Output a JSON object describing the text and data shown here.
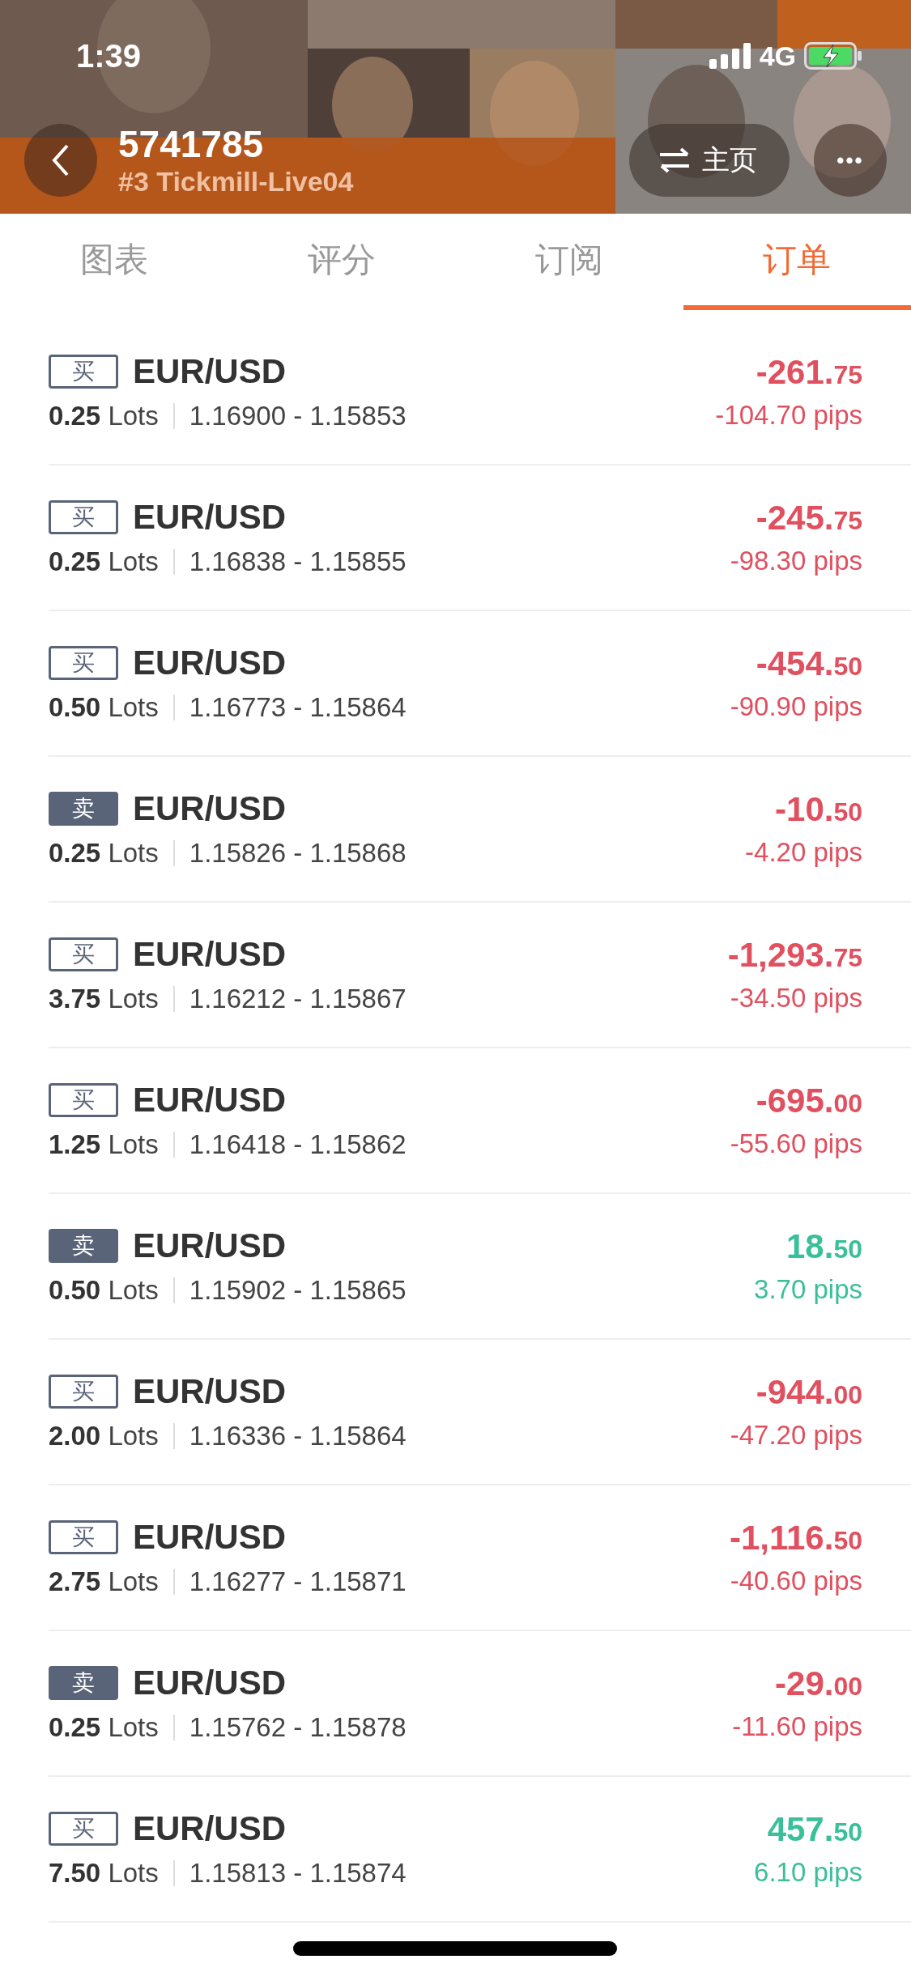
{
  "status_bar": {
    "time": "1:39",
    "network": "4G"
  },
  "header": {
    "title": "5741785",
    "subtitle": "#3 Tickmill-Live04",
    "home_button": "主页",
    "more_button": "•••"
  },
  "tabs": [
    {
      "label": "图表",
      "selected": false
    },
    {
      "label": "评分",
      "selected": false
    },
    {
      "label": "订阅",
      "selected": false
    },
    {
      "label": "订单",
      "selected": true
    }
  ],
  "orders": [
    {
      "sell": false,
      "side_label": "买",
      "symbol": "EUR/USD",
      "lots": "0.25",
      "lots_unit": "Lots",
      "prices": "1.16900 - 1.15853",
      "profit": false,
      "amount_main": "-261.",
      "amount_minor": "75",
      "pips": "-104.70 pips"
    },
    {
      "sell": false,
      "side_label": "买",
      "symbol": "EUR/USD",
      "lots": "0.25",
      "lots_unit": "Lots",
      "prices": "1.16838 - 1.15855",
      "profit": false,
      "amount_main": "-245.",
      "amount_minor": "75",
      "pips": "-98.30 pips"
    },
    {
      "sell": false,
      "side_label": "买",
      "symbol": "EUR/USD",
      "lots": "0.50",
      "lots_unit": "Lots",
      "prices": "1.16773 - 1.15864",
      "profit": false,
      "amount_main": "-454.",
      "amount_minor": "50",
      "pips": "-90.90 pips"
    },
    {
      "sell": true,
      "side_label": "卖",
      "symbol": "EUR/USD",
      "lots": "0.25",
      "lots_unit": "Lots",
      "prices": "1.15826 - 1.15868",
      "profit": false,
      "amount_main": "-10.",
      "amount_minor": "50",
      "pips": "-4.20 pips"
    },
    {
      "sell": false,
      "side_label": "买",
      "symbol": "EUR/USD",
      "lots": "3.75",
      "lots_unit": "Lots",
      "prices": "1.16212 - 1.15867",
      "profit": false,
      "amount_main": "-1,293.",
      "amount_minor": "75",
      "pips": "-34.50 pips"
    },
    {
      "sell": false,
      "side_label": "买",
      "symbol": "EUR/USD",
      "lots": "1.25",
      "lots_unit": "Lots",
      "prices": "1.16418 - 1.15862",
      "profit": false,
      "amount_main": "-695.",
      "amount_minor": "00",
      "pips": "-55.60 pips"
    },
    {
      "sell": true,
      "side_label": "卖",
      "symbol": "EUR/USD",
      "lots": "0.50",
      "lots_unit": "Lots",
      "prices": "1.15902 - 1.15865",
      "profit": true,
      "amount_main": "18.",
      "amount_minor": "50",
      "pips": "3.70 pips"
    },
    {
      "sell": false,
      "side_label": "买",
      "symbol": "EUR/USD",
      "lots": "2.00",
      "lots_unit": "Lots",
      "prices": "1.16336 - 1.15864",
      "profit": false,
      "amount_main": "-944.",
      "amount_minor": "00",
      "pips": "-47.20 pips"
    },
    {
      "sell": false,
      "side_label": "买",
      "symbol": "EUR/USD",
      "lots": "2.75",
      "lots_unit": "Lots",
      "prices": "1.16277 - 1.15871",
      "profit": false,
      "amount_main": "-1,116.",
      "amount_minor": "50",
      "pips": "-40.60 pips"
    },
    {
      "sell": true,
      "side_label": "卖",
      "symbol": "EUR/USD",
      "lots": "0.25",
      "lots_unit": "Lots",
      "prices": "1.15762 - 1.15878",
      "profit": false,
      "amount_main": "-29.",
      "amount_minor": "00",
      "pips": "-11.60 pips"
    },
    {
      "sell": false,
      "side_label": "买",
      "symbol": "EUR/USD",
      "lots": "7.50",
      "lots_unit": "Lots",
      "prices": "1.15813 - 1.15874",
      "profit": true,
      "amount_main": "457.",
      "amount_minor": "50",
      "pips": "6.10 pips"
    }
  ]
}
